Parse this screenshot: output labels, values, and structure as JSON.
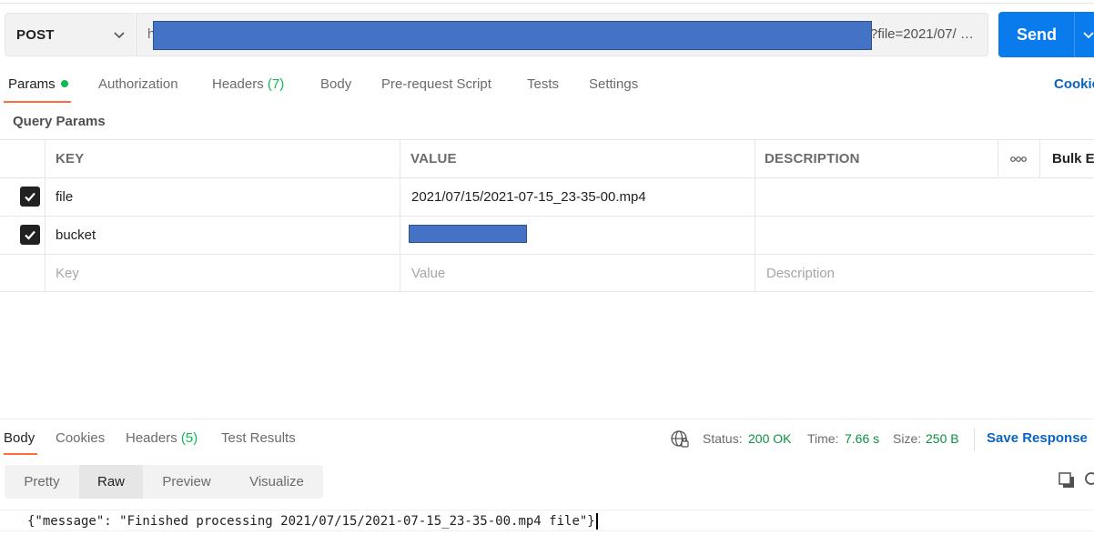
{
  "request": {
    "method": "POST",
    "url_prefix": "h",
    "url_tail": "?file=2021/07/ …",
    "send_label": "Send"
  },
  "tabs": [
    {
      "label": "Params",
      "active": true,
      "dot": true
    },
    {
      "label": "Authorization"
    },
    {
      "label": "Headers",
      "count": "(7)"
    },
    {
      "label": "Body"
    },
    {
      "label": "Pre-request Script"
    },
    {
      "label": "Tests"
    },
    {
      "label": "Settings"
    }
  ],
  "cookies_link": "Cookie",
  "query_params": {
    "title": "Query Params",
    "columns": [
      "KEY",
      "VALUE",
      "DESCRIPTION"
    ],
    "bulk_edit": "Bulk E",
    "rows": [
      {
        "checked": true,
        "key": "file",
        "value": "2021/07/15/2021-07-15_23-35-00.mp4",
        "description": ""
      },
      {
        "checked": true,
        "key": "bucket",
        "value": "",
        "value_redacted": true,
        "description": ""
      }
    ],
    "placeholder": {
      "key": "Key",
      "value": "Value",
      "description": "Description"
    }
  },
  "response": {
    "tabs": [
      {
        "label": "Body",
        "active": true
      },
      {
        "label": "Cookies"
      },
      {
        "label": "Headers",
        "count": "(5)"
      },
      {
        "label": "Test Results"
      }
    ],
    "status_label": "Status:",
    "status_value": "200 OK",
    "time_label": "Time:",
    "time_value": "7.66 s",
    "size_label": "Size:",
    "size_value": "250 B",
    "save_label": "Save Response",
    "view_modes": [
      {
        "label": "Pretty"
      },
      {
        "label": "Raw",
        "active": true
      },
      {
        "label": "Preview"
      },
      {
        "label": "Visualize"
      }
    ],
    "body_text": "{\"message\": \"Finished processing 2021/07/15/2021-07-15_23-35-00.mp4 file\"}"
  },
  "colors": {
    "accent_orange": "#ff6c37",
    "send_blue": "#097bed",
    "link_blue": "#0b63c1",
    "status_green": "#0c8f41",
    "redaction": "#4472c4"
  }
}
